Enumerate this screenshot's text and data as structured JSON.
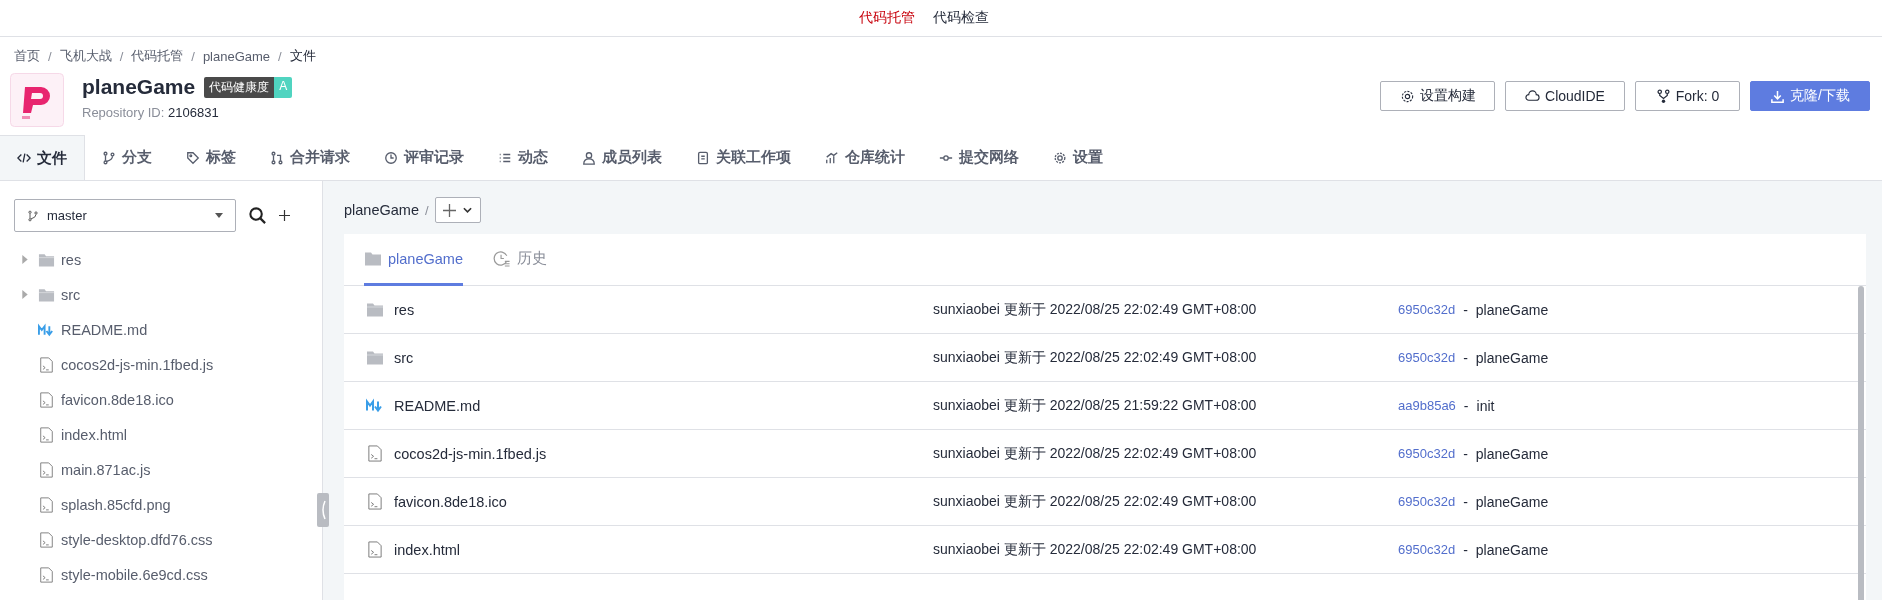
{
  "top_nav": [
    {
      "label": "代码托管",
      "selected": true
    },
    {
      "label": "代码检查",
      "selected": false
    }
  ],
  "breadcrumb": {
    "separator": "/",
    "items": [
      "首页",
      "飞机大战",
      "代码托管",
      "planeGame",
      "文件"
    ]
  },
  "repo": {
    "name": "planeGame",
    "health_label": "代码健康度",
    "health_grade": "A",
    "id_label": "Repository ID:",
    "id": "2106831"
  },
  "actions": [
    {
      "label": "设置构建",
      "primary": false
    },
    {
      "label": "CloudIDE",
      "primary": false
    },
    {
      "label": "Fork: 0",
      "primary": false
    },
    {
      "label": "克隆/下载",
      "primary": true
    }
  ],
  "tabs": [
    {
      "label": "文件",
      "selected": true
    },
    {
      "label": "分支",
      "selected": false
    },
    {
      "label": "标签",
      "selected": false
    },
    {
      "label": "合并请求",
      "selected": false
    },
    {
      "label": "评审记录",
      "selected": false
    },
    {
      "label": "动态",
      "selected": false
    },
    {
      "label": "成员列表",
      "selected": false
    },
    {
      "label": "关联工作项",
      "selected": false
    },
    {
      "label": "仓库统计",
      "selected": false
    },
    {
      "label": "提交网络",
      "selected": false
    },
    {
      "label": "设置",
      "selected": false
    }
  ],
  "sidebar": {
    "branch": "master",
    "tree": [
      {
        "kind": "folder",
        "name": "res",
        "expanded": false
      },
      {
        "kind": "folder",
        "name": "src",
        "expanded": false
      },
      {
        "kind": "markdown",
        "name": "README.md"
      },
      {
        "kind": "file",
        "name": "cocos2d-js-min.1fbed.js"
      },
      {
        "kind": "file",
        "name": "favicon.8de18.ico"
      },
      {
        "kind": "file",
        "name": "index.html"
      },
      {
        "kind": "file",
        "name": "main.871ac.js"
      },
      {
        "kind": "file",
        "name": "splash.85cfd.png"
      },
      {
        "kind": "file",
        "name": "style-desktop.dfd76.css"
      },
      {
        "kind": "file",
        "name": "style-mobile.6e9cd.css"
      }
    ]
  },
  "path": {
    "root": "planeGame",
    "separator": "/"
  },
  "panel_tabs": [
    {
      "label": "planeGame",
      "selected": true
    },
    {
      "label": "历史",
      "selected": false
    }
  ],
  "files": [
    {
      "kind": "folder",
      "name": "res",
      "updated": "sunxiaobei 更新于 2022/08/25 22:02:49 GMT+08:00",
      "commit": "6950c32d",
      "separator": "-",
      "message": "planeGame"
    },
    {
      "kind": "folder",
      "name": "src",
      "updated": "sunxiaobei 更新于 2022/08/25 22:02:49 GMT+08:00",
      "commit": "6950c32d",
      "separator": "-",
      "message": "planeGame"
    },
    {
      "kind": "markdown",
      "name": "README.md",
      "updated": "sunxiaobei 更新于 2022/08/25 21:59:22 GMT+08:00",
      "commit": "aa9b85a6",
      "separator": "-",
      "message": "init"
    },
    {
      "kind": "file",
      "name": "cocos2d-js-min.1fbed.js",
      "updated": "sunxiaobei 更新于 2022/08/25 22:02:49 GMT+08:00",
      "commit": "6950c32d",
      "separator": "-",
      "message": "planeGame"
    },
    {
      "kind": "file",
      "name": "favicon.8de18.ico",
      "updated": "sunxiaobei 更新于 2022/08/25 22:02:49 GMT+08:00",
      "commit": "6950c32d",
      "separator": "-",
      "message": "planeGame"
    },
    {
      "kind": "file",
      "name": "index.html",
      "updated": "sunxiaobei 更新于 2022/08/25 22:02:49 GMT+08:00",
      "commit": "6950c32d",
      "separator": "-",
      "message": "planeGame"
    }
  ]
}
